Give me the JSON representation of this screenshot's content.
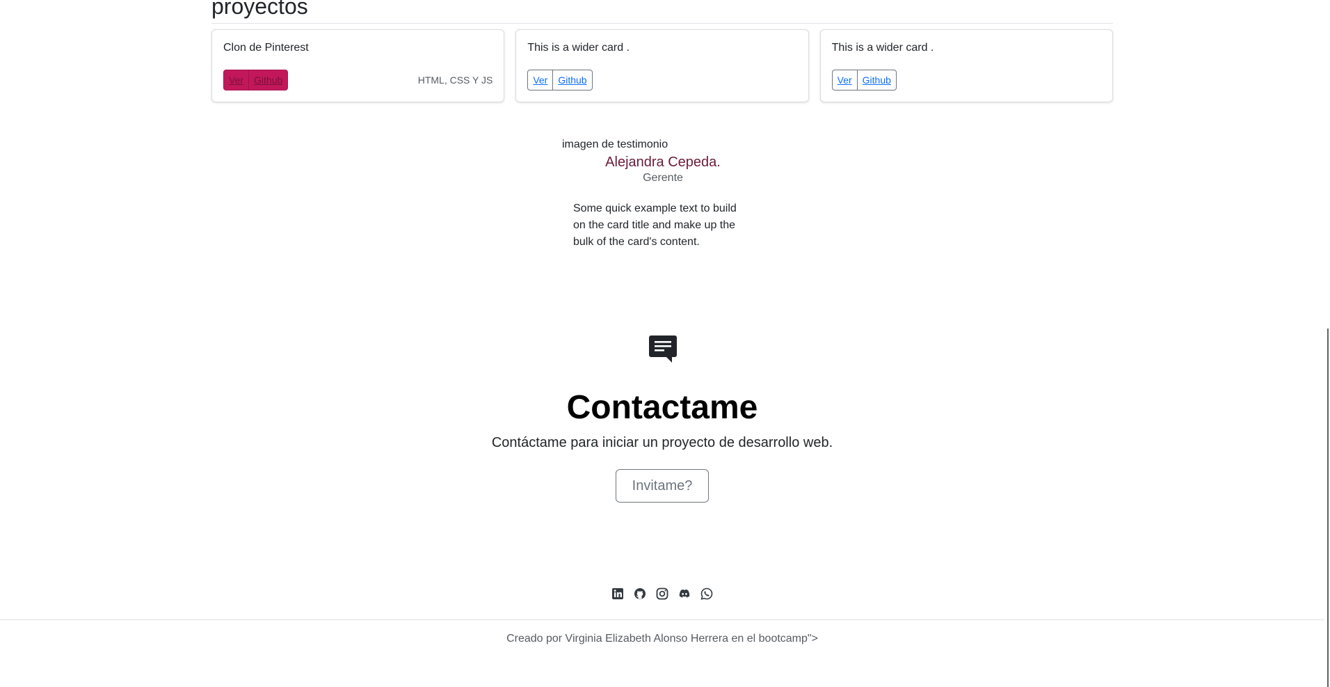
{
  "section": {
    "title": "proyectos"
  },
  "cards": [
    {
      "title": "Clon de Pinterest",
      "ver_label": "Ver",
      "github_label": "Github",
      "tech": "HTML, CSS Y JS"
    },
    {
      "title": "This is a wider card .",
      "ver_label": "Ver",
      "github_label": "Github"
    },
    {
      "title": "This is a wider card .",
      "ver_label": "Ver",
      "github_label": "Github"
    }
  ],
  "testimonial": {
    "image_alt": "imagen de testimonio",
    "name": "Alejandra Cepeda.",
    "role": "Gerente",
    "text": "Some quick example text to build on the card title and make up the bulk of the card's content."
  },
  "contact": {
    "icon": "chat-message-icon",
    "title": "Contactame",
    "subtitle": "Contáctame para iniciar un proyecto de desarrollo web.",
    "button_label": "Invitame?"
  },
  "footer": {
    "social_icons": [
      "linkedin-icon",
      "github-icon",
      "instagram-icon",
      "discord-icon",
      "whatsapp-icon"
    ],
    "credit": "Creado por Virginia Elizabeth Alonso Herrera en el bootcamp\">"
  },
  "colors": {
    "accent": "#c2185b",
    "name_color": "#6b1a3a",
    "link": "#0d6efd"
  }
}
